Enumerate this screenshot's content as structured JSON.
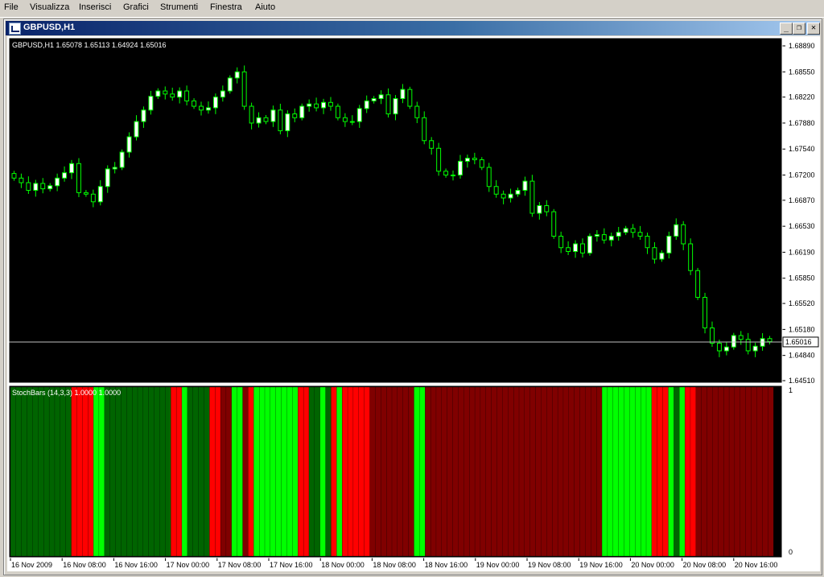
{
  "menu": [
    "File",
    "Visualizza",
    "Inserisci",
    "Grafici",
    "Strumenti",
    "Finestra",
    "Aiuto"
  ],
  "window": {
    "title": "GBPUSD,H1",
    "buttons": {
      "minimize": "_",
      "restore": "❐",
      "close": "✕"
    }
  },
  "colors": {
    "background": "#000000",
    "bull_candle": "#ffffff",
    "bear_candle": "#000000",
    "wick": "#00ff00",
    "axis": "#ffffff",
    "price_line": "#c0c0c0",
    "stoch_up_strong": "#00ff00",
    "stoch_up_weak": "#006400",
    "stoch_down_strong": "#ff0000",
    "stoch_down_weak": "#800000"
  },
  "chart_data": {
    "type": "candlestick",
    "symbol_info": "GBPUSD,H1  1.65078 1.65113 1.64924 1.65016",
    "y_ticks": [
      "1.68890",
      "1.68550",
      "1.68220",
      "1.67880",
      "1.67540",
      "1.67200",
      "1.66870",
      "1.66530",
      "1.66190",
      "1.65850",
      "1.65520",
      "1.65180",
      "1.64840",
      "1.64510"
    ],
    "y_range": [
      1.6451,
      1.6889
    ],
    "last_price_label": "1.65016",
    "last_price": 1.65016,
    "x_ticks": [
      "16 Nov 2009",
      "16 Nov 08:00",
      "16 Nov 16:00",
      "17 Nov 00:00",
      "17 Nov 08:00",
      "17 Nov 16:00",
      "18 Nov 00:00",
      "18 Nov 08:00",
      "18 Nov 16:00",
      "19 Nov 00:00",
      "19 Nov 08:00",
      "19 Nov 16:00",
      "20 Nov 00:00",
      "20 Nov 08:00",
      "20 Nov 16:00"
    ],
    "closes": [
      1.6716,
      1.671,
      1.67,
      1.6709,
      1.6702,
      1.6706,
      1.6716,
      1.6723,
      1.6735,
      1.6697,
      1.6695,
      1.6685,
      1.6705,
      1.6728,
      1.673,
      1.675,
      1.677,
      1.679,
      1.6805,
      1.6823,
      1.683,
      1.6826,
      1.6822,
      1.683,
      1.6817,
      1.681,
      1.6805,
      1.6808,
      1.6822,
      1.683,
      1.6847,
      1.6855,
      1.681,
      1.6788,
      1.6795,
      1.679,
      1.6805,
      1.6778,
      1.68,
      1.6795,
      1.681,
      1.6813,
      1.6808,
      1.6815,
      1.681,
      1.6795,
      1.679,
      1.679,
      1.6807,
      1.6817,
      1.682,
      1.6825,
      1.68,
      1.682,
      1.6832,
      1.681,
      1.6795,
      1.6765,
      1.6755,
      1.6725,
      1.672,
      1.672,
      1.6738,
      1.6742,
      1.674,
      1.673,
      1.6705,
      1.6695,
      1.669,
      1.6695,
      1.67,
      1.6712,
      1.667,
      1.668,
      1.6672,
      1.664,
      1.6625,
      1.662,
      1.663,
      1.6618,
      1.664,
      1.6642,
      1.6635,
      1.664,
      1.6645,
      1.665,
      1.6645,
      1.664,
      1.6625,
      1.661,
      1.6618,
      1.664,
      1.6655,
      1.663,
      1.6595,
      1.656,
      1.652,
      1.65,
      1.649,
      1.6495,
      1.651,
      1.6505,
      1.649,
      1.6496,
      1.6506,
      1.6502
    ],
    "stoch_colors": [
      "dg",
      "dg",
      "dg",
      "dg",
      "dg",
      "dg",
      "dg",
      "dg",
      "dg",
      "dg",
      "dg",
      "r",
      "r",
      "r",
      "r",
      "lg",
      "lg",
      "dg",
      "dg",
      "dg",
      "dg",
      "dg",
      "dg",
      "dg",
      "dg",
      "dg",
      "dg",
      "dg",
      "dg",
      "r",
      "r",
      "lg",
      "dg",
      "dg",
      "dg",
      "dg",
      "r",
      "r",
      "dr",
      "dr",
      "lg",
      "lg",
      "dr",
      "r",
      "lg",
      "lg",
      "lg",
      "lg",
      "lg",
      "lg",
      "lg",
      "lg",
      "r",
      "r",
      "dg",
      "dg",
      "lg",
      "dg",
      "r",
      "lg",
      "r",
      "r",
      "r",
      "r",
      "r",
      "dr",
      "dr",
      "dr",
      "dr",
      "dr",
      "dr",
      "dr",
      "dr",
      "lg",
      "lg",
      "dr",
      "dr",
      "dr",
      "dr",
      "dr",
      "dr",
      "dr",
      "dr",
      "dr",
      "dr",
      "dr",
      "dr",
      "dr",
      "dr",
      "dr",
      "dr",
      "dr",
      "dr",
      "dr",
      "dr",
      "dr",
      "dr",
      "dr",
      "dr",
      "dr",
      "dr",
      "dr",
      "dr",
      "dr",
      "dr",
      "dr",
      "dr",
      "lg",
      "lg",
      "lg",
      "lg",
      "lg",
      "lg",
      "lg",
      "lg",
      "lg",
      "r",
      "r",
      "r",
      "lg",
      "dg",
      "lg",
      "r",
      "r",
      "dr",
      "dr",
      "dr",
      "dr",
      "dr",
      "dr",
      "dr",
      "dr",
      "dr",
      "dr",
      "dr",
      "dr",
      "dr",
      "dr"
    ],
    "indicator_label": "StochBars (14,3,3) 1.0000 1.0000",
    "indicator_scale": [
      "1",
      "0"
    ]
  }
}
